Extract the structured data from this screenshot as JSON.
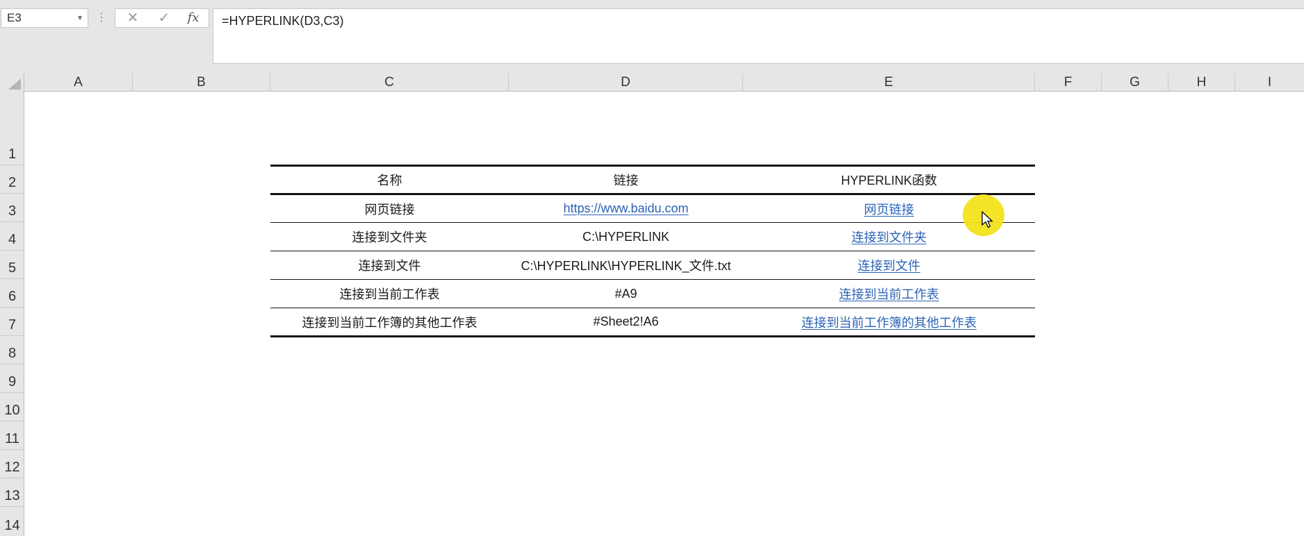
{
  "formula_bar": {
    "name_box": "E3",
    "cancel_icon": "close-icon",
    "enter_icon": "check-icon",
    "fx_label": "fx",
    "formula": "=HYPERLINK(D3,C3)"
  },
  "columns": [
    "A",
    "B",
    "C",
    "D",
    "E",
    "F",
    "G",
    "H",
    "I"
  ],
  "rows": [
    "1",
    "2",
    "3",
    "4",
    "5",
    "6",
    "7",
    "8",
    "9",
    "10",
    "11",
    "12",
    "13",
    "14"
  ],
  "table": {
    "headers": [
      "名称",
      "链接",
      "HYPERLINK函数"
    ],
    "rows": [
      {
        "name": "网页链接",
        "link": "https://www.baidu.com",
        "result": "网页链接"
      },
      {
        "name": "连接到文件夹",
        "link": "C:\\HYPERLINK",
        "result": "连接到文件夹"
      },
      {
        "name": "连接到文件",
        "link": "C:\\HYPERLINK\\HYPERLINK_文件.txt",
        "result": "连接到文件"
      },
      {
        "name": "连接到当前工作表",
        "link": "#A9",
        "result": "连接到当前工作表"
      },
      {
        "name": "连接到当前工作簿的其他工作表",
        "link": "#Sheet2!A6",
        "result": "连接到当前工作簿的其他工作表"
      }
    ]
  },
  "colors": {
    "link": "#2b62b6",
    "highlight": "#f3e31c",
    "header_bg": "#e6e6e6"
  }
}
